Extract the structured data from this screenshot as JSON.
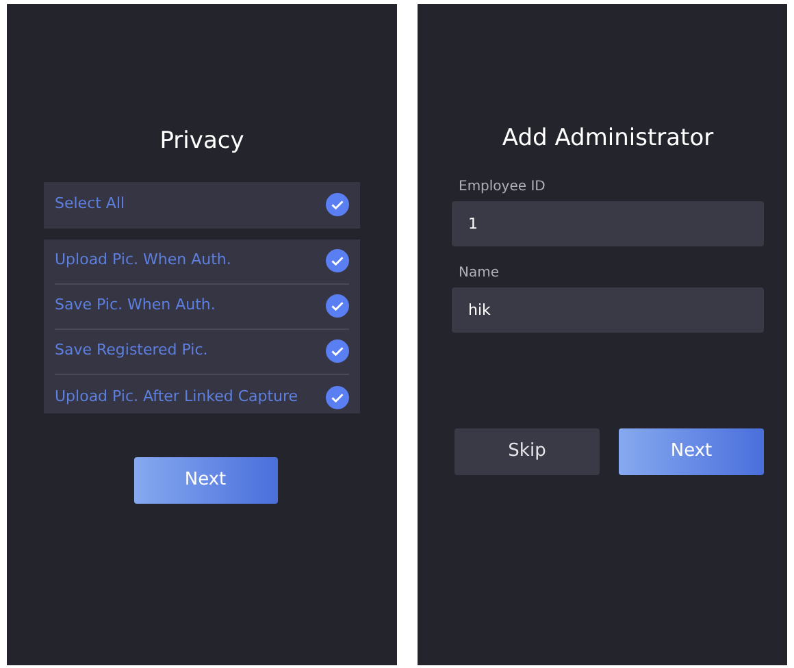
{
  "privacy_screen": {
    "title": "Privacy",
    "select_all": {
      "label": "Select All",
      "checked": true
    },
    "options": [
      {
        "label": "Upload Pic. When Auth.",
        "checked": true
      },
      {
        "label": "Save Pic. When Auth.",
        "checked": true
      },
      {
        "label": "Save Registered Pic.",
        "checked": true
      },
      {
        "label": "Upload Pic. After Linked Capture",
        "checked": true
      }
    ],
    "button": "Next"
  },
  "admin_screen": {
    "title": "Add Administrator",
    "fields": [
      {
        "label": "Employee ID",
        "value": "1"
      },
      {
        "label": "Name",
        "value": "hik"
      }
    ],
    "buttons": [
      {
        "label": "Skip",
        "kind": "secondary"
      },
      {
        "label": "Next",
        "kind": "primary"
      }
    ]
  }
}
